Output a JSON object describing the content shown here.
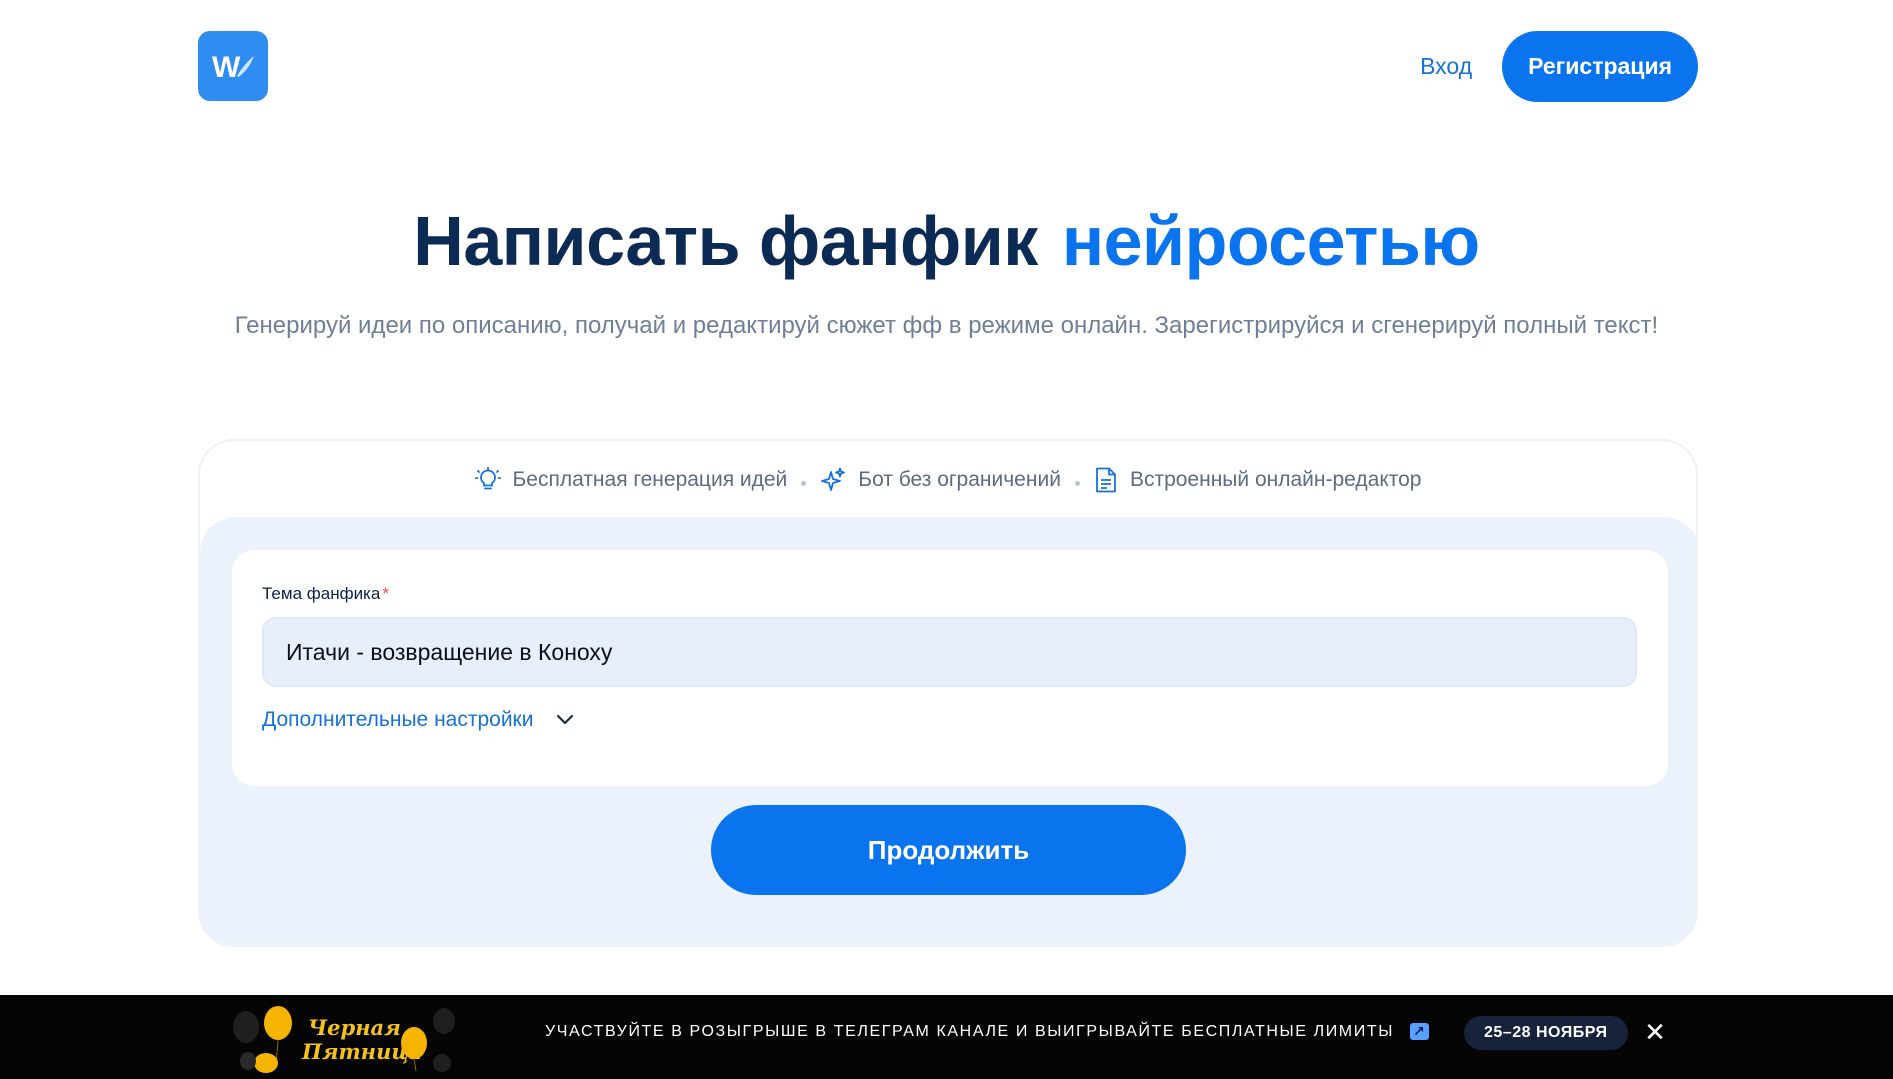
{
  "header": {
    "logo_letter": "W",
    "login_label": "Вход",
    "register_label": "Регистрация"
  },
  "hero": {
    "title_main": "Написать фанфик",
    "title_accent": "нейросетью",
    "subtitle": "Генерируй идеи по описанию, получай и редактируй сюжет фф в режиме онлайн. Зарегистрируйся и сгенерируй полный текст!"
  },
  "features": [
    {
      "label": "Бесплатная генерация идей",
      "icon": "lightbulb-icon"
    },
    {
      "label": "Бот без ограничений",
      "icon": "sparkles-icon"
    },
    {
      "label": "Встроенный онлайн-редактор",
      "icon": "document-icon"
    }
  ],
  "form": {
    "topic_label": "Тема фанфика",
    "required_mark": "*",
    "topic_value": "Итачи - возвращение в Коноху",
    "advanced_label": "Дополнительные настройки",
    "continue_label": "Продолжить"
  },
  "promo": {
    "art_text_line1": "Черная",
    "art_text_line2": "Пятница",
    "text": "УЧАСТВУЙТЕ В РОЗЫГРЫШЕ В ТЕЛЕГРАМ КАНАЛЕ И ВЫИГРЫВАЙТЕ БЕСПЛАТНЫЕ ЛИМИТЫ",
    "arrow": "↗",
    "date": "25–28 НОЯБРЯ",
    "close": "✕"
  },
  "colors": {
    "accent": "#0a74ef",
    "title_dark": "#0b2a54",
    "panel_bg": "#ebf2fb",
    "promo_bg": "#050505"
  }
}
